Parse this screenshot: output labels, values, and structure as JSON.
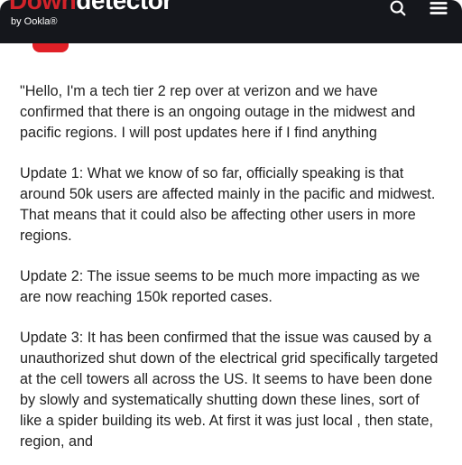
{
  "header": {
    "logo_down": "Down",
    "logo_detector": "detector",
    "byline": "by Ookla®",
    "search_icon": "search",
    "menu_icon": "menu"
  },
  "post": {
    "paragraphs": [
      "\"Hello, I'm a tech tier 2 rep over at verizon and we have confirmed that there is an ongoing outage in the midwest and pacific regions. I will post updates here if I find anything",
      "Update 1: What we know of so far, officially speaking is that around 50k users are affected mainly in the pacific and midwest. That means that it could also be affecting other users in more regions.",
      "Update 2: The issue seems to be much more impacting as we are now reaching 150k reported cases.",
      "Update 3: It has been confirmed that the issue was caused by a unauthorized shut down of the electrical grid specifically targeted at the cell towers all across the US. It seems to have been done by slowly and systematically shutting down these lines, sort of like a spider building its web. At first it was just local , then state, region, and"
    ]
  }
}
